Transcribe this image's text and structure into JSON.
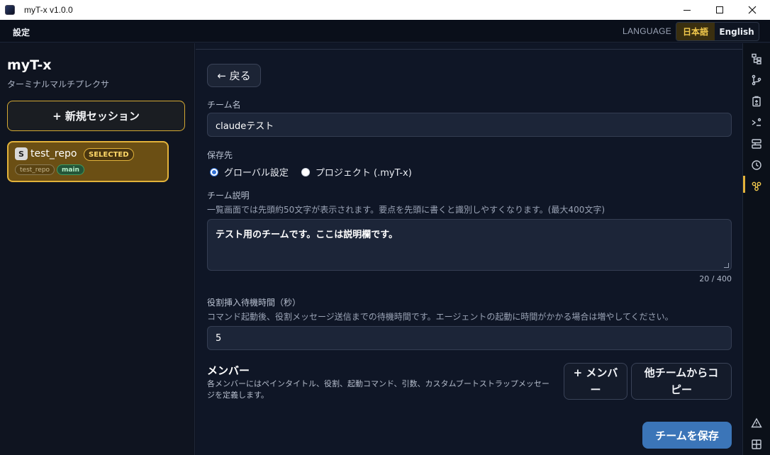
{
  "window": {
    "title": "myT-x v1.0.0"
  },
  "menubar": {
    "settings_label": "設定",
    "language_label": "LANGUAGE",
    "lang_ja": "日本語",
    "lang_en": "English"
  },
  "sidebar": {
    "app_name": "myT-x",
    "app_subtitle": "ターミナルマルチプレクサ",
    "new_session_label": "+ 新規セッション",
    "session": {
      "badge": "S",
      "name": "test_repo",
      "selected_label": "SELECTED",
      "repo_tag": "test_repo",
      "branch_tag": "main"
    }
  },
  "main": {
    "back_label": "← 戻る",
    "team_name": {
      "label": "チーム名",
      "value": "claudeテスト"
    },
    "save_location": {
      "label": "保存先",
      "options": [
        {
          "label": "グローバル設定",
          "selected": true
        },
        {
          "label": "プロジェクト (.myT-x)",
          "selected": false
        }
      ]
    },
    "description": {
      "label": "チーム説明",
      "hint": "一覧画面では先頭約50文字が表示されます。要点を先頭に書くと識別しやすくなります。(最大400文字)",
      "value": "テスト用のチームです。ここは説明欄です。",
      "counter": "20 / 400"
    },
    "wait_time": {
      "label": "役割挿入待機時間（秒）",
      "hint": "コマンド起動後、役割メッセージ送信までの待機時間です。エージェントの起動に時間がかかる場合は増やしてください。",
      "value": "5"
    },
    "members": {
      "title": "メンバー",
      "hint": "各メンバーにはペインタイトル、役割、起動コマンド、引数、カスタムブートストラップメッセージを定義します。",
      "add_label": "+ メンバー",
      "copy_label": "他チームからコピー"
    },
    "save_label": "チームを保存"
  },
  "rail": {
    "icons": [
      "file-tree-icon",
      "git-branch-icon",
      "clipboard-icon",
      "terminal-icon",
      "layout-icon",
      "history-icon",
      "team-icon",
      "warning-icon",
      "grid-icon"
    ],
    "active_icon": "team-icon",
    "accent": "#e2b23a"
  }
}
